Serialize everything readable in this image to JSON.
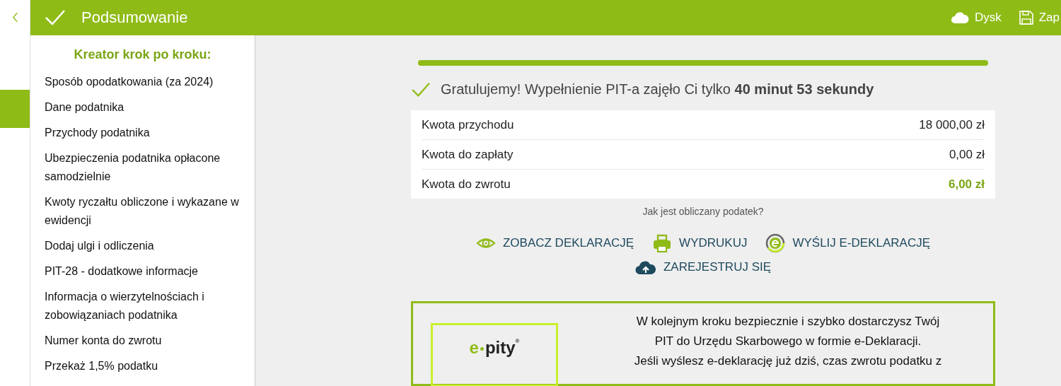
{
  "header": {
    "title": "Podsumowanie",
    "actions": [
      {
        "kind": "cloud",
        "label": "Dysk"
      },
      {
        "kind": "save",
        "label": "Zap"
      }
    ]
  },
  "sidebar": {
    "heading": "Kreator krok po kroku:",
    "items": [
      {
        "label": "Sposób opodatkowania (za 2024)",
        "selected": false
      },
      {
        "label": "Dane podatnika",
        "selected": false
      },
      {
        "label": "Przychody podatnika",
        "selected": false
      },
      {
        "label": "Ubezpieczenia podatnika opłacone samodzielnie",
        "selected": false
      },
      {
        "label": "Kwoty ryczałtu obliczone i wykazane w ewidencji",
        "selected": false
      },
      {
        "label": "Dodaj ulgi i odliczenia",
        "selected": false
      },
      {
        "label": "PIT-28 - dodatkowe informacje",
        "selected": false
      },
      {
        "label": "Informacja o wierzytelnościach i zobowiązaniach  podatnika",
        "selected": false
      },
      {
        "label": "Numer konta do zwrotu",
        "selected": false
      },
      {
        "label": "Przekaż 1,5% podatku",
        "selected": false
      }
    ]
  },
  "progress": {
    "level": 1
  },
  "message": "Gratulujemy! Wypełnienie PIT-a zajęło Ci tylko **40 minut 53 sekundy**",
  "summary": [
    {
      "label": "Kwota przychodu",
      "value": "18 000,00 zł",
      "highlight": false
    },
    {
      "label": "Kwota do zapłaty",
      "value": "0,00 zł",
      "highlight": false
    },
    {
      "label": "Kwota do zwrotu",
      "value": "6,00 zł",
      "highlight": true
    }
  ],
  "help_link": "Jak jest obliczany podatek?",
  "actions": [
    {
      "kind": "eye",
      "label": "ZOBACZ DEKLARACJĘ"
    },
    {
      "kind": "print",
      "label": "WYDRUKUJ"
    },
    {
      "kind": "edecl",
      "label": "WYŚLIJ E-DEKLARACJĘ"
    },
    {
      "kind": "upload",
      "label": "ZAREJESTRUJ SIĘ"
    }
  ],
  "promo": {
    "logo": {
      "accent": "e",
      "rest": "pity",
      "mark": "®"
    },
    "text": [
      "W kolejnym kroku bezpiecznie i szybko dostarczysz Twój",
      "PIT do Urzędu Skarbowego w formie e-Deklaracji.",
      "Jeśli wyślesz e-deklarację już dziś, czas zwrotu podatku z"
    ]
  }
}
